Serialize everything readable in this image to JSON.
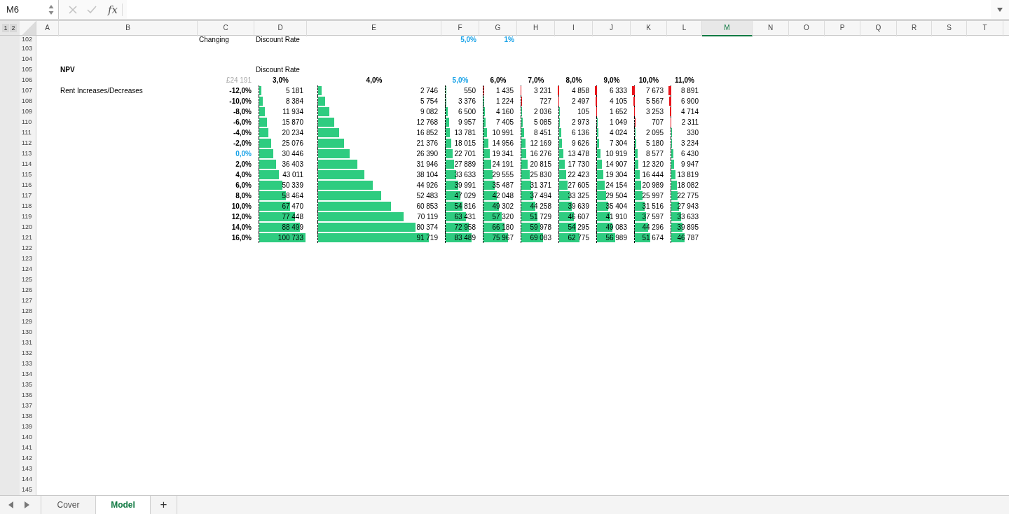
{
  "name_box": {
    "value": "M6"
  },
  "formula_bar": {
    "fx": "fx"
  },
  "outline_levels": [
    {
      "label": "1"
    },
    {
      "label": "2"
    }
  ],
  "columns": [
    {
      "label": "A",
      "selected": false
    },
    {
      "label": "B",
      "selected": false
    },
    {
      "label": "C",
      "selected": false
    },
    {
      "label": "D",
      "selected": false
    },
    {
      "label": "E",
      "selected": false
    },
    {
      "label": "F",
      "selected": false
    },
    {
      "label": "G",
      "selected": false
    },
    {
      "label": "H",
      "selected": false
    },
    {
      "label": "I",
      "selected": false
    },
    {
      "label": "J",
      "selected": false
    },
    {
      "label": "K",
      "selected": false
    },
    {
      "label": "L",
      "selected": false
    },
    {
      "label": "M",
      "selected": true
    },
    {
      "label": "N",
      "selected": false
    },
    {
      "label": "O",
      "selected": false
    },
    {
      "label": "P",
      "selected": false
    },
    {
      "label": "Q",
      "selected": false
    },
    {
      "label": "R",
      "selected": false
    },
    {
      "label": "S",
      "selected": false
    },
    {
      "label": "T",
      "selected": false
    }
  ],
  "rows": [
    {
      "number": "102",
      "cells": {
        "C": {
          "kind": "label",
          "text": "Changing",
          "bold": false,
          "accent": false
        },
        "D": {
          "kind": "label",
          "text": "Discount Rate",
          "bold": false,
          "accent": false
        },
        "F": {
          "kind": "value",
          "text": "5,0%",
          "bold": true,
          "accent": true
        },
        "G": {
          "kind": "value",
          "text": "1%",
          "bold": true,
          "accent": true
        }
      }
    },
    {
      "number": "103"
    },
    {
      "number": "104"
    },
    {
      "number": "105",
      "cells": {
        "B": {
          "kind": "label",
          "text": "NPV",
          "bold": true,
          "accent": false
        },
        "D": {
          "kind": "label",
          "text": "Discount Rate",
          "bold": false,
          "accent": false
        }
      }
    },
    {
      "number": "106",
      "cells": {
        "C": {
          "kind": "faint",
          "text": "£24 191",
          "bold": false,
          "accent": false
        },
        "D": {
          "kind": "heading",
          "text": "3,0%",
          "bold": true,
          "accent": false
        },
        "E": {
          "kind": "heading",
          "text": "4,0%",
          "bold": true,
          "accent": false
        },
        "F": {
          "kind": "heading",
          "text": "5,0%",
          "bold": true,
          "accent": true
        },
        "G": {
          "kind": "heading",
          "text": "6,0%",
          "bold": true,
          "accent": false
        },
        "H": {
          "kind": "heading",
          "text": "7,0%",
          "bold": true,
          "accent": false
        },
        "I": {
          "kind": "heading",
          "text": "8,0%",
          "bold": true,
          "accent": false
        },
        "J": {
          "kind": "heading",
          "text": "9,0%",
          "bold": true,
          "accent": false
        },
        "K": {
          "kind": "heading",
          "text": "10,0%",
          "bold": true,
          "accent": false
        },
        "L": {
          "kind": "heading",
          "text": "11,0%",
          "bold": true,
          "accent": false
        }
      }
    },
    {
      "number": "107",
      "cells": {
        "B": {
          "kind": "label",
          "text": "Rent Increases/Decreases",
          "bold": false,
          "accent": false
        },
        "C": {
          "kind": "value",
          "text": "-12,0%",
          "bold": true,
          "accent": false
        },
        "D": {
          "kind": "bar",
          "text": "5 181",
          "level": 0.05,
          "negative": false
        },
        "E": {
          "kind": "bar",
          "text": "2 746",
          "level": 0.03,
          "negative": false
        },
        "F": {
          "kind": "bar",
          "text": "550",
          "level": 0.01,
          "negative": false
        },
        "G": {
          "kind": "bar",
          "text": "1 435",
          "level": 0.01,
          "negative": true
        },
        "H": {
          "kind": "bar",
          "text": "3 231",
          "level": 0.03,
          "negative": true
        },
        "I": {
          "kind": "bar",
          "text": "4 858",
          "level": 0.05,
          "negative": true
        },
        "J": {
          "kind": "bar",
          "text": "6 333",
          "level": 0.06,
          "negative": true
        },
        "K": {
          "kind": "bar",
          "text": "7 673",
          "level": 0.08,
          "negative": true
        },
        "L": {
          "kind": "bar",
          "text": "8 891",
          "level": 0.09,
          "negative": true
        }
      }
    },
    {
      "number": "108",
      "cells": {
        "C": {
          "kind": "value",
          "text": "-10,0%",
          "bold": true,
          "accent": false
        },
        "D": {
          "kind": "bar",
          "text": "8 384",
          "level": 0.08,
          "negative": false
        },
        "E": {
          "kind": "bar",
          "text": "5 754",
          "level": 0.06,
          "negative": false
        },
        "F": {
          "kind": "bar",
          "text": "3 376",
          "level": 0.03,
          "negative": false
        },
        "G": {
          "kind": "bar",
          "text": "1 224",
          "level": 0.01,
          "negative": false
        },
        "H": {
          "kind": "bar",
          "text": "727",
          "level": 0.01,
          "negative": true
        },
        "I": {
          "kind": "bar",
          "text": "2 497",
          "level": 0.02,
          "negative": true
        },
        "J": {
          "kind": "bar",
          "text": "4 105",
          "level": 0.04,
          "negative": true
        },
        "K": {
          "kind": "bar",
          "text": "5 567",
          "level": 0.05,
          "negative": true
        },
        "L": {
          "kind": "bar",
          "text": "6 900",
          "level": 0.07,
          "negative": true
        }
      }
    },
    {
      "number": "109",
      "cells": {
        "C": {
          "kind": "value",
          "text": "-8,0%",
          "bold": true,
          "accent": false
        },
        "D": {
          "kind": "bar",
          "text": "11 934",
          "level": 0.12,
          "negative": false
        },
        "E": {
          "kind": "bar",
          "text": "9 082",
          "level": 0.09,
          "negative": false
        },
        "F": {
          "kind": "bar",
          "text": "6 500",
          "level": 0.06,
          "negative": false
        },
        "G": {
          "kind": "bar",
          "text": "4 160",
          "level": 0.04,
          "negative": false
        },
        "H": {
          "kind": "bar",
          "text": "2 036",
          "level": 0.02,
          "negative": false
        },
        "I": {
          "kind": "bar",
          "text": "105",
          "level": 0.002,
          "negative": false
        },
        "J": {
          "kind": "bar",
          "text": "1 652",
          "level": 0.02,
          "negative": true
        },
        "K": {
          "kind": "bar",
          "text": "3 253",
          "level": 0.03,
          "negative": true
        },
        "L": {
          "kind": "bar",
          "text": "4 714",
          "level": 0.05,
          "negative": true
        }
      }
    },
    {
      "number": "110",
      "cells": {
        "C": {
          "kind": "value",
          "text": "-6,0%",
          "bold": true,
          "accent": false
        },
        "D": {
          "kind": "bar",
          "text": "15 870",
          "level": 0.16,
          "negative": false
        },
        "E": {
          "kind": "bar",
          "text": "12 768",
          "level": 0.13,
          "negative": false
        },
        "F": {
          "kind": "bar",
          "text": "9 957",
          "level": 0.1,
          "negative": false
        },
        "G": {
          "kind": "bar",
          "text": "7 405",
          "level": 0.07,
          "negative": false
        },
        "H": {
          "kind": "bar",
          "text": "5 085",
          "level": 0.05,
          "negative": false
        },
        "I": {
          "kind": "bar",
          "text": "2 973",
          "level": 0.03,
          "negative": false
        },
        "J": {
          "kind": "bar",
          "text": "1 049",
          "level": 0.01,
          "negative": false
        },
        "K": {
          "kind": "bar",
          "text": "707",
          "level": 0.01,
          "negative": true
        },
        "L": {
          "kind": "bar",
          "text": "2 311",
          "level": 0.02,
          "negative": true
        }
      }
    },
    {
      "number": "111",
      "cells": {
        "C": {
          "kind": "value",
          "text": "-4,0%",
          "bold": true,
          "accent": false
        },
        "D": {
          "kind": "bar",
          "text": "20 234",
          "level": 0.2,
          "negative": false
        },
        "E": {
          "kind": "bar",
          "text": "16 852",
          "level": 0.17,
          "negative": false
        },
        "F": {
          "kind": "bar",
          "text": "13 781",
          "level": 0.13,
          "negative": false
        },
        "G": {
          "kind": "bar",
          "text": "10 991",
          "level": 0.11,
          "negative": false
        },
        "H": {
          "kind": "bar",
          "text": "8 451",
          "level": 0.08,
          "negative": false
        },
        "I": {
          "kind": "bar",
          "text": "6 136",
          "level": 0.06,
          "negative": false
        },
        "J": {
          "kind": "bar",
          "text": "4 024",
          "level": 0.04,
          "negative": false
        },
        "K": {
          "kind": "bar",
          "text": "2 095",
          "level": 0.02,
          "negative": false
        },
        "L": {
          "kind": "bar",
          "text": "330",
          "level": 0.003,
          "negative": false
        }
      }
    },
    {
      "number": "112",
      "cells": {
        "C": {
          "kind": "value",
          "text": "-2,0%",
          "bold": true,
          "accent": false
        },
        "D": {
          "kind": "bar",
          "text": "25 076",
          "level": 0.25,
          "negative": false
        },
        "E": {
          "kind": "bar",
          "text": "21 376",
          "level": 0.21,
          "negative": false
        },
        "F": {
          "kind": "bar",
          "text": "18 015",
          "level": 0.17,
          "negative": false
        },
        "G": {
          "kind": "bar",
          "text": "14 956",
          "level": 0.15,
          "negative": false
        },
        "H": {
          "kind": "bar",
          "text": "12 169",
          "level": 0.12,
          "negative": false
        },
        "I": {
          "kind": "bar",
          "text": "9 626",
          "level": 0.09,
          "negative": false
        },
        "J": {
          "kind": "bar",
          "text": "7 304",
          "level": 0.07,
          "negative": false
        },
        "K": {
          "kind": "bar",
          "text": "5 180",
          "level": 0.05,
          "negative": false
        },
        "L": {
          "kind": "bar",
          "text": "3 234",
          "level": 0.03,
          "negative": false
        }
      }
    },
    {
      "number": "113",
      "cells": {
        "C": {
          "kind": "value",
          "text": "0,0%",
          "bold": true,
          "accent": true
        },
        "D": {
          "kind": "bar",
          "text": "30 446",
          "level": 0.3,
          "negative": false
        },
        "E": {
          "kind": "bar",
          "text": "26 390",
          "level": 0.26,
          "negative": false
        },
        "F": {
          "kind": "bar",
          "text": "22 701",
          "level": 0.22,
          "negative": false
        },
        "G": {
          "kind": "bar",
          "text": "19 341",
          "level": 0.19,
          "negative": false
        },
        "H": {
          "kind": "bar",
          "text": "16 276",
          "level": 0.16,
          "negative": false
        },
        "I": {
          "kind": "bar",
          "text": "13 478",
          "level": 0.13,
          "negative": false
        },
        "J": {
          "kind": "bar",
          "text": "10 919",
          "level": 0.11,
          "negative": false
        },
        "K": {
          "kind": "bar",
          "text": "8 577",
          "level": 0.08,
          "negative": false
        },
        "L": {
          "kind": "bar",
          "text": "6 430",
          "level": 0.06,
          "negative": false
        }
      }
    },
    {
      "number": "114",
      "cells": {
        "C": {
          "kind": "value",
          "text": "2,0%",
          "bold": true,
          "accent": false
        },
        "D": {
          "kind": "bar",
          "text": "36 403",
          "level": 0.36,
          "negative": false
        },
        "E": {
          "kind": "bar",
          "text": "31 946",
          "level": 0.32,
          "negative": false
        },
        "F": {
          "kind": "bar",
          "text": "27 889",
          "level": 0.27,
          "negative": false
        },
        "G": {
          "kind": "bar",
          "text": "24 191",
          "level": 0.24,
          "negative": false
        },
        "H": {
          "kind": "bar",
          "text": "20 815",
          "level": 0.2,
          "negative": false
        },
        "I": {
          "kind": "bar",
          "text": "17 730",
          "level": 0.17,
          "negative": false
        },
        "J": {
          "kind": "bar",
          "text": "14 907",
          "level": 0.15,
          "negative": false
        },
        "K": {
          "kind": "bar",
          "text": "12 320",
          "level": 0.12,
          "negative": false
        },
        "L": {
          "kind": "bar",
          "text": "9 947",
          "level": 0.1,
          "negative": false
        }
      }
    },
    {
      "number": "115",
      "cells": {
        "C": {
          "kind": "value",
          "text": "4,0%",
          "bold": true,
          "accent": false
        },
        "D": {
          "kind": "bar",
          "text": "43 011",
          "level": 0.43,
          "negative": false
        },
        "E": {
          "kind": "bar",
          "text": "38 104",
          "level": 0.38,
          "negative": false
        },
        "F": {
          "kind": "bar",
          "text": "33 633",
          "level": 0.33,
          "negative": false
        },
        "G": {
          "kind": "bar",
          "text": "29 555",
          "level": 0.29,
          "negative": false
        },
        "H": {
          "kind": "bar",
          "text": "25 830",
          "level": 0.25,
          "negative": false
        },
        "I": {
          "kind": "bar",
          "text": "22 423",
          "level": 0.22,
          "negative": false
        },
        "J": {
          "kind": "bar",
          "text": "19 304",
          "level": 0.19,
          "negative": false
        },
        "K": {
          "kind": "bar",
          "text": "16 444",
          "level": 0.16,
          "negative": false
        },
        "L": {
          "kind": "bar",
          "text": "13 819",
          "level": 0.14,
          "negative": false
        }
      }
    },
    {
      "number": "116",
      "cells": {
        "C": {
          "kind": "value",
          "text": "6,0%",
          "bold": true,
          "accent": false
        },
        "D": {
          "kind": "bar",
          "text": "50 339",
          "level": 0.5,
          "negative": false
        },
        "E": {
          "kind": "bar",
          "text": "44 926",
          "level": 0.45,
          "negative": false
        },
        "F": {
          "kind": "bar",
          "text": "39 991",
          "level": 0.39,
          "negative": false
        },
        "G": {
          "kind": "bar",
          "text": "35 487",
          "level": 0.35,
          "negative": false
        },
        "H": {
          "kind": "bar",
          "text": "31 371",
          "level": 0.31,
          "negative": false
        },
        "I": {
          "kind": "bar",
          "text": "27 605",
          "level": 0.27,
          "negative": false
        },
        "J": {
          "kind": "bar",
          "text": "24 154",
          "level": 0.24,
          "negative": false
        },
        "K": {
          "kind": "bar",
          "text": "20 989",
          "level": 0.21,
          "negative": false
        },
        "L": {
          "kind": "bar",
          "text": "18 082",
          "level": 0.18,
          "negative": false
        }
      }
    },
    {
      "number": "117",
      "cells": {
        "C": {
          "kind": "value",
          "text": "8,0%",
          "bold": true,
          "accent": false
        },
        "D": {
          "kind": "bar",
          "text": "58 464",
          "level": 0.58,
          "negative": false
        },
        "E": {
          "kind": "bar",
          "text": "52 483",
          "level": 0.52,
          "negative": false
        },
        "F": {
          "kind": "bar",
          "text": "47 029",
          "level": 0.46,
          "negative": false
        },
        "G": {
          "kind": "bar",
          "text": "42 048",
          "level": 0.41,
          "negative": false
        },
        "H": {
          "kind": "bar",
          "text": "37 494",
          "level": 0.37,
          "negative": false
        },
        "I": {
          "kind": "bar",
          "text": "33 325",
          "level": 0.33,
          "negative": false
        },
        "J": {
          "kind": "bar",
          "text": "29 504",
          "level": 0.29,
          "negative": false
        },
        "K": {
          "kind": "bar",
          "text": "25 997",
          "level": 0.25,
          "negative": false
        },
        "L": {
          "kind": "bar",
          "text": "22 775",
          "level": 0.22,
          "negative": false
        }
      }
    },
    {
      "number": "118",
      "cells": {
        "C": {
          "kind": "value",
          "text": "10,0%",
          "bold": true,
          "accent": false
        },
        "D": {
          "kind": "bar",
          "text": "67 470",
          "level": 0.67,
          "negative": false
        },
        "E": {
          "kind": "bar",
          "text": "60 853",
          "level": 0.6,
          "negative": false
        },
        "F": {
          "kind": "bar",
          "text": "54 816",
          "level": 0.53,
          "negative": false
        },
        "G": {
          "kind": "bar",
          "text": "49 302",
          "level": 0.48,
          "negative": false
        },
        "H": {
          "kind": "bar",
          "text": "44 258",
          "level": 0.44,
          "negative": false
        },
        "I": {
          "kind": "bar",
          "text": "39 639",
          "level": 0.39,
          "negative": false
        },
        "J": {
          "kind": "bar",
          "text": "35 404",
          "level": 0.35,
          "negative": false
        },
        "K": {
          "kind": "bar",
          "text": "31 516",
          "level": 0.31,
          "negative": false
        },
        "L": {
          "kind": "bar",
          "text": "27 943",
          "level": 0.27,
          "negative": false
        }
      }
    },
    {
      "number": "119",
      "cells": {
        "C": {
          "kind": "value",
          "text": "12,0%",
          "bold": true,
          "accent": false
        },
        "D": {
          "kind": "bar",
          "text": "77 448",
          "level": 0.77,
          "negative": false
        },
        "E": {
          "kind": "bar",
          "text": "70 119",
          "level": 0.7,
          "negative": false
        },
        "F": {
          "kind": "bar",
          "text": "63 431",
          "level": 0.62,
          "negative": false
        },
        "G": {
          "kind": "bar",
          "text": "57 320",
          "level": 0.56,
          "negative": false
        },
        "H": {
          "kind": "bar",
          "text": "51 729",
          "level": 0.51,
          "negative": false
        },
        "I": {
          "kind": "bar",
          "text": "46 607",
          "level": 0.46,
          "negative": false
        },
        "J": {
          "kind": "bar",
          "text": "41 910",
          "level": 0.41,
          "negative": false
        },
        "K": {
          "kind": "bar",
          "text": "37 597",
          "level": 0.37,
          "negative": false
        },
        "L": {
          "kind": "bar",
          "text": "33 633",
          "level": 0.33,
          "negative": false
        }
      }
    },
    {
      "number": "120",
      "cells": {
        "C": {
          "kind": "value",
          "text": "14,0%",
          "bold": true,
          "accent": false
        },
        "D": {
          "kind": "bar",
          "text": "88 499",
          "level": 0.88,
          "negative": false
        },
        "E": {
          "kind": "bar",
          "text": "80 374",
          "level": 0.8,
          "negative": false
        },
        "F": {
          "kind": "bar",
          "text": "72 958",
          "level": 0.71,
          "negative": false
        },
        "G": {
          "kind": "bar",
          "text": "66 180",
          "level": 0.65,
          "negative": false
        },
        "H": {
          "kind": "bar",
          "text": "59 978",
          "level": 0.59,
          "negative": false
        },
        "I": {
          "kind": "bar",
          "text": "54 295",
          "level": 0.53,
          "negative": false
        },
        "J": {
          "kind": "bar",
          "text": "49 083",
          "level": 0.48,
          "negative": false
        },
        "K": {
          "kind": "bar",
          "text": "44 296",
          "level": 0.43,
          "negative": false
        },
        "L": {
          "kind": "bar",
          "text": "39 895",
          "level": 0.39,
          "negative": false
        }
      }
    },
    {
      "number": "121",
      "cells": {
        "C": {
          "kind": "value",
          "text": "16,0%",
          "bold": true,
          "accent": false
        },
        "D": {
          "kind": "bar",
          "text": "100 733",
          "level": 1.0,
          "negative": false
        },
        "E": {
          "kind": "bar",
          "text": "91 719",
          "level": 0.91,
          "negative": false
        },
        "F": {
          "kind": "bar",
          "text": "83 489",
          "level": 0.81,
          "negative": false
        },
        "G": {
          "kind": "bar",
          "text": "75 967",
          "level": 0.75,
          "negative": false
        },
        "H": {
          "kind": "bar",
          "text": "69 083",
          "level": 0.68,
          "negative": false
        },
        "I": {
          "kind": "bar",
          "text": "62 775",
          "level": 0.62,
          "negative": false
        },
        "J": {
          "kind": "bar",
          "text": "56 989",
          "level": 0.56,
          "negative": false
        },
        "K": {
          "kind": "bar",
          "text": "51 674",
          "level": 0.51,
          "negative": false
        },
        "L": {
          "kind": "bar",
          "text": "46 787",
          "level": 0.46,
          "negative": false
        }
      }
    },
    {
      "number": "122"
    },
    {
      "number": "123"
    },
    {
      "number": "124"
    },
    {
      "number": "125"
    },
    {
      "number": "126"
    },
    {
      "number": "127"
    },
    {
      "number": "128"
    },
    {
      "number": "129"
    },
    {
      "number": "130"
    },
    {
      "number": "131"
    },
    {
      "number": "132"
    },
    {
      "number": "133"
    },
    {
      "number": "134"
    },
    {
      "number": "135"
    },
    {
      "number": "136"
    },
    {
      "number": "137"
    },
    {
      "number": "138"
    },
    {
      "number": "139"
    },
    {
      "number": "140"
    },
    {
      "number": "141"
    },
    {
      "number": "142"
    },
    {
      "number": "143"
    },
    {
      "number": "144"
    },
    {
      "number": "145"
    }
  ],
  "sheet_tabs": [
    {
      "label": "Cover",
      "selected": false
    },
    {
      "label": "Model",
      "selected": true
    }
  ],
  "add_sheet": {
    "label": "+"
  }
}
